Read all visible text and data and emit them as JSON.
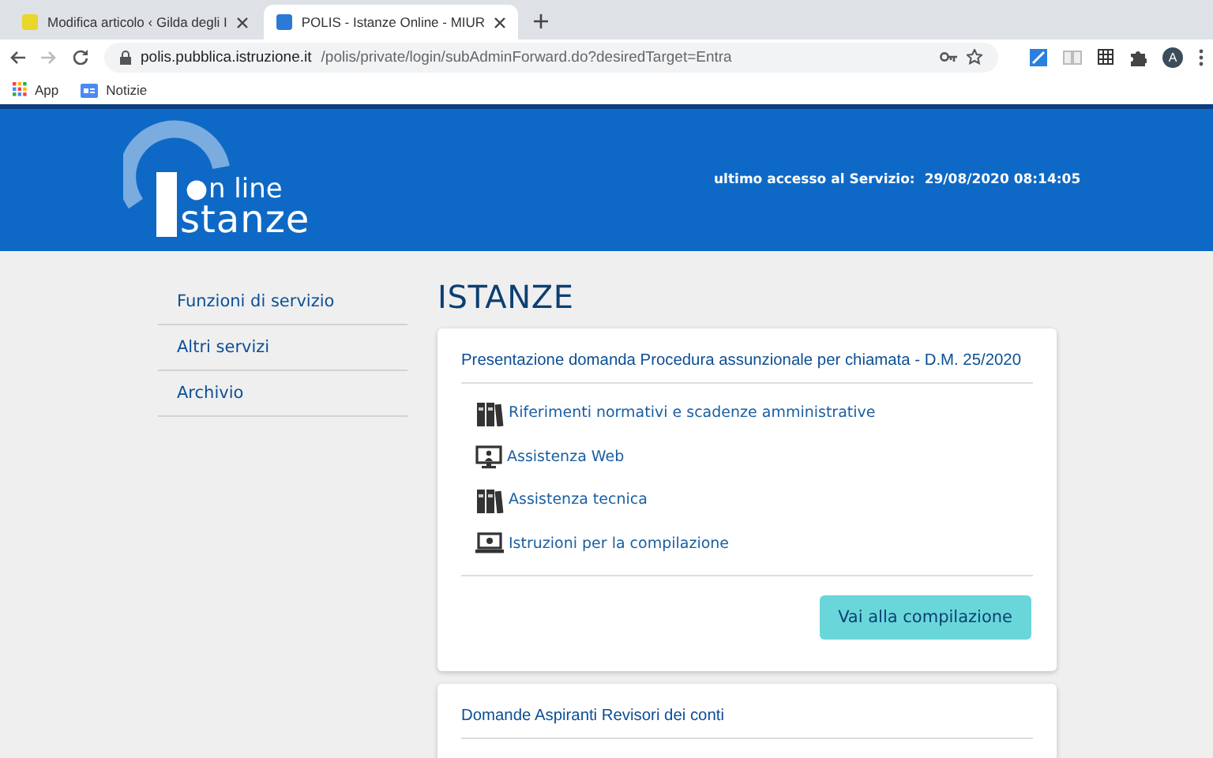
{
  "browser": {
    "tabs": [
      {
        "title": "Modifica articolo ‹ Gilda degli I",
        "selected": false,
        "color": "#e8d62a"
      },
      {
        "title": "POLIS - Istanze Online - MIUR",
        "selected": true,
        "color": "#2a7bd5"
      }
    ],
    "url_host": "polis.pubblica.istruzione.it",
    "url_path": "/polis/private/login/subAdminForward.do?desiredTarget=Entra",
    "profile": "A",
    "bookmarks": [
      {
        "label": "App",
        "kind": "apps"
      },
      {
        "label": "Notizie",
        "kind": "news"
      }
    ]
  },
  "header": {
    "logo_line1": "n line",
    "logo_line2": "stanze",
    "last_access_label": "ultimo accesso al Servizio:",
    "last_access_value": "29/08/2020 08:14:05"
  },
  "sidebar": {
    "items": [
      "Funzioni di servizio",
      "Altri servizi",
      "Archivio"
    ]
  },
  "main": {
    "title": "ISTANZE",
    "cards": [
      {
        "title": "Presentazione domanda Procedura assunzionale per chiamata - D.M. 25/2020",
        "links": [
          {
            "label": "Riferimenti normativi e scadenze amministrative",
            "kind": "binders"
          },
          {
            "label": "Assistenza Web",
            "kind": "monitor"
          },
          {
            "label": "Assistenza tecnica",
            "kind": "binders"
          },
          {
            "label": "Istruzioni per la compilazione",
            "kind": "laptop"
          }
        ],
        "button": "Vai alla compilazione"
      },
      {
        "title": "Domande Aspiranti Revisori dei conti"
      }
    ]
  }
}
